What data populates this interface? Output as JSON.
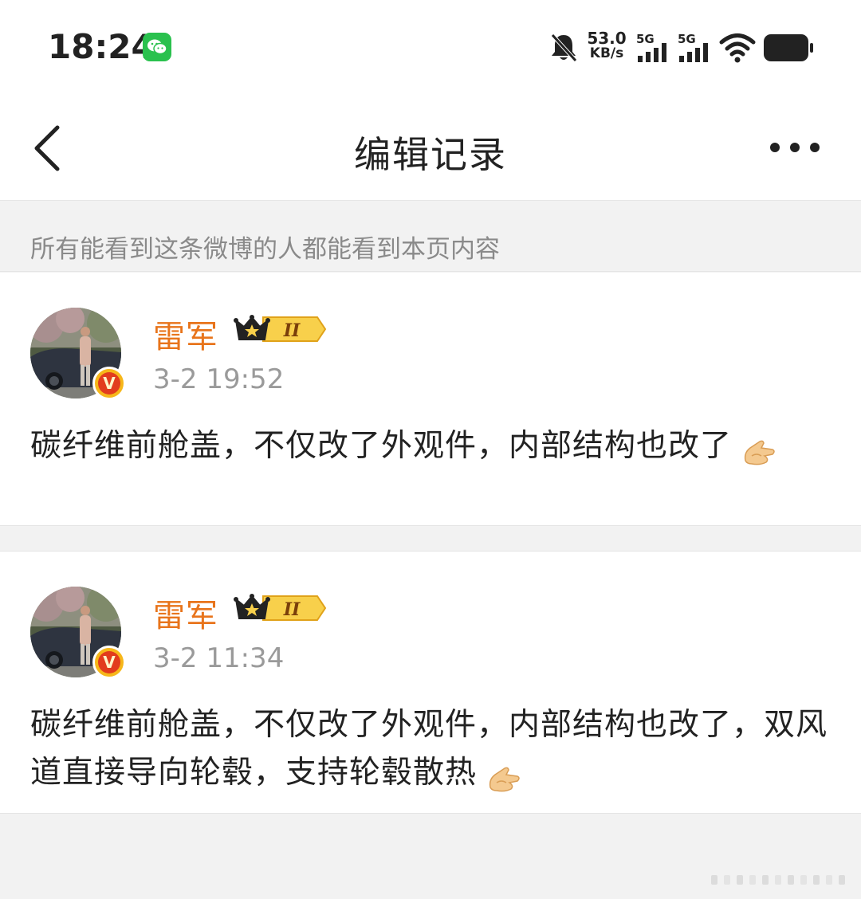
{
  "status_bar": {
    "time": "18:24",
    "net_speed_value": "53.0",
    "net_speed_unit": "KB/s",
    "signal1_label": "5G",
    "signal2_label": "5G",
    "icons": [
      "wechat-icon",
      "bell-muted-icon",
      "signal-icon",
      "wifi-icon",
      "battery-icon"
    ]
  },
  "header": {
    "title": "编辑记录",
    "back_icon": "chevron-left-icon",
    "more_icon": "more-dots-icon"
  },
  "notice": {
    "text": "所有能看到这条微博的人都能看到本页内容"
  },
  "records": [
    {
      "username": "雷军",
      "time": "3-2 19:52",
      "text": "碳纤维前舱盖，不仅改了外观件，内部结构也改了",
      "vip_level": "II",
      "verified_mark": "V"
    },
    {
      "username": "雷军",
      "time": "3-2 11:34",
      "text": "碳纤维前舱盖，不仅改了外观件，内部结构也改了，双风道直接导向轮毂，支持轮毂散热",
      "vip_level": "II",
      "verified_mark": "V"
    }
  ],
  "colors": {
    "username": "#e8741b",
    "page_bg": "#f2f2f2",
    "card_bg": "#ffffff",
    "muted_text": "#8a8a8a"
  }
}
